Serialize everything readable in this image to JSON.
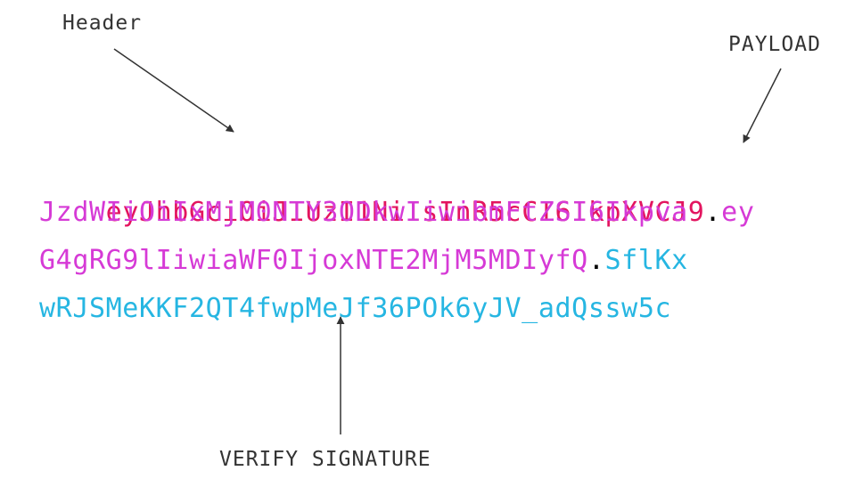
{
  "labels": {
    "header": "Header",
    "payload": "PAYLOAD",
    "signature": "VERIFY SIGNATURE"
  },
  "token": {
    "lines": [
      [
        {
          "part": "header",
          "text": "eyJhbGciOiJIUzI1NiIsInR5cCI6IkpXVCJ9"
        },
        {
          "part": "dot",
          "text": "."
        },
        {
          "part": "payload",
          "text": "ey"
        }
      ],
      [
        {
          "part": "payload",
          "text": "JzdWIiOiIxMjM0NTY3ODkwIiwibmFtZSI6Ikpva"
        }
      ],
      [
        {
          "part": "payload",
          "text": "G4gRG9lIiwiaWF0IjoxNTE2MjM5MDIyfQ"
        },
        {
          "part": "dot",
          "text": "."
        },
        {
          "part": "signature",
          "text": "SflKx"
        }
      ],
      [
        {
          "part": "signature",
          "text": "wRJSMeKKF2QT4fwpMeJf36POk6yJV_adQssw5c"
        }
      ]
    ]
  },
  "colors": {
    "header": "#e3155f",
    "payload": "#d63ad6",
    "signature": "#26b6e2",
    "dot": "#000000",
    "label": "#333333"
  }
}
